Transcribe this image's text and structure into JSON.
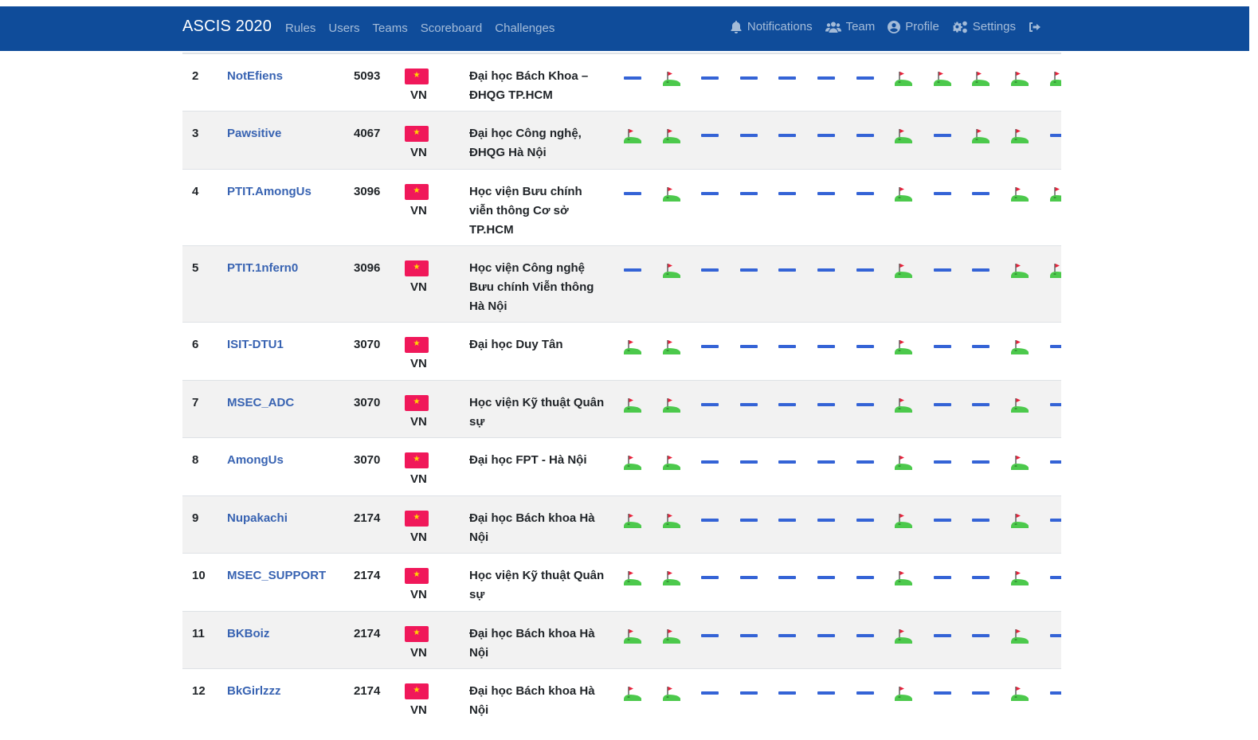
{
  "brand": "ASCIS 2020",
  "nav": {
    "links": [
      "Rules",
      "Users",
      "Teams",
      "Scoreboard",
      "Challenges"
    ],
    "notifications": "Notifications",
    "team": "Team",
    "profile": "Profile",
    "settings": "Settings",
    "icons": {
      "notifications": "bell-icon",
      "team": "users-icon",
      "profile": "user-circle-icon",
      "settings": "gears-icon",
      "logout": "sign-out-icon"
    }
  },
  "colors": {
    "navbar": "#0f4c9a",
    "link": "#3863b2",
    "flag": "#f0185a",
    "unsolved": "#3463d6",
    "solved": "#4cc94c"
  },
  "rows": [
    {
      "place": "2",
      "team": "NotEfiens",
      "score": "5093",
      "country": "VN",
      "affiliation": "Đại học Bách Khoa – ĐHQG TP.HCM",
      "solves": [
        0,
        1,
        0,
        0,
        0,
        0,
        0,
        1,
        1,
        1,
        1,
        1
      ]
    },
    {
      "place": "3",
      "team": "Pawsitive",
      "score": "4067",
      "country": "VN",
      "affiliation": "Đại học Công nghệ, ĐHQG Hà Nội",
      "solves": [
        1,
        1,
        0,
        0,
        0,
        0,
        0,
        1,
        0,
        1,
        1,
        0
      ]
    },
    {
      "place": "4",
      "team": "PTIT.AmongUs",
      "score": "3096",
      "country": "VN",
      "affiliation": "Học viện Bưu chính viễn thông Cơ sở TP.HCM",
      "solves": [
        0,
        1,
        0,
        0,
        0,
        0,
        0,
        1,
        0,
        0,
        1,
        1
      ]
    },
    {
      "place": "5",
      "team": "PTIT.1nfern0",
      "score": "3096",
      "country": "VN",
      "affiliation": "Học viện Công nghệ Bưu chính Viễn thông Hà Nội",
      "solves": [
        0,
        1,
        0,
        0,
        0,
        0,
        0,
        1,
        0,
        0,
        1,
        1
      ]
    },
    {
      "place": "6",
      "team": "ISIT-DTU1",
      "score": "3070",
      "country": "VN",
      "affiliation": "Đại học Duy Tân",
      "solves": [
        1,
        1,
        0,
        0,
        0,
        0,
        0,
        1,
        0,
        0,
        1,
        0
      ]
    },
    {
      "place": "7",
      "team": "MSEC_ADC",
      "score": "3070",
      "country": "VN",
      "affiliation": "Học viện Kỹ thuật Quân sự",
      "solves": [
        1,
        1,
        0,
        0,
        0,
        0,
        0,
        1,
        0,
        0,
        1,
        0
      ]
    },
    {
      "place": "8",
      "team": "AmongUs",
      "score": "3070",
      "country": "VN",
      "affiliation": "Đại học FPT - Hà Nội",
      "solves": [
        1,
        1,
        0,
        0,
        0,
        0,
        0,
        1,
        0,
        0,
        1,
        0
      ]
    },
    {
      "place": "9",
      "team": "Nupakachi",
      "score": "2174",
      "country": "VN",
      "affiliation": "Đại học Bách khoa Hà Nội",
      "solves": [
        1,
        1,
        0,
        0,
        0,
        0,
        0,
        1,
        0,
        0,
        1,
        0
      ]
    },
    {
      "place": "10",
      "team": "MSEC_SUPPORT",
      "score": "2174",
      "country": "VN",
      "affiliation": "Học viện Kỹ thuật Quân sự",
      "solves": [
        1,
        1,
        0,
        0,
        0,
        0,
        0,
        1,
        0,
        0,
        1,
        0
      ]
    },
    {
      "place": "11",
      "team": "BKBoiz",
      "score": "2174",
      "country": "VN",
      "affiliation": "Đại học Bách khoa Hà Nội",
      "solves": [
        1,
        1,
        0,
        0,
        0,
        0,
        0,
        1,
        0,
        0,
        1,
        0
      ]
    },
    {
      "place": "12",
      "team": "BkGirlzzz",
      "score": "2174",
      "country": "VN",
      "affiliation": "Đại học Bách khoa Hà Nội",
      "solves": [
        1,
        1,
        0,
        0,
        0,
        0,
        0,
        1,
        0,
        0,
        1,
        0
      ]
    }
  ]
}
